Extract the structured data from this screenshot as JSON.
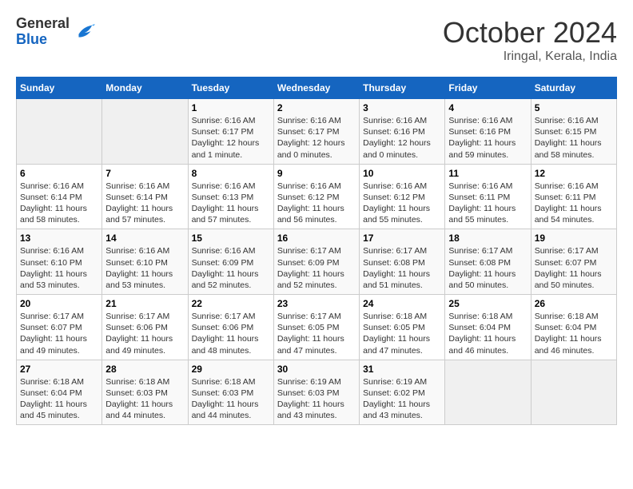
{
  "header": {
    "logo_general": "General",
    "logo_blue": "Blue",
    "month_title": "October 2024",
    "subtitle": "Iringal, Kerala, India"
  },
  "calendar": {
    "weekdays": [
      "Sunday",
      "Monday",
      "Tuesday",
      "Wednesday",
      "Thursday",
      "Friday",
      "Saturday"
    ],
    "weeks": [
      [
        {
          "day": "",
          "sunrise": "",
          "sunset": "",
          "daylight": "",
          "empty": true
        },
        {
          "day": "",
          "sunrise": "",
          "sunset": "",
          "daylight": "",
          "empty": true
        },
        {
          "day": "1",
          "sunrise": "Sunrise: 6:16 AM",
          "sunset": "Sunset: 6:17 PM",
          "daylight": "Daylight: 12 hours and 1 minute.",
          "empty": false
        },
        {
          "day": "2",
          "sunrise": "Sunrise: 6:16 AM",
          "sunset": "Sunset: 6:17 PM",
          "daylight": "Daylight: 12 hours and 0 minutes.",
          "empty": false
        },
        {
          "day": "3",
          "sunrise": "Sunrise: 6:16 AM",
          "sunset": "Sunset: 6:16 PM",
          "daylight": "Daylight: 12 hours and 0 minutes.",
          "empty": false
        },
        {
          "day": "4",
          "sunrise": "Sunrise: 6:16 AM",
          "sunset": "Sunset: 6:16 PM",
          "daylight": "Daylight: 11 hours and 59 minutes.",
          "empty": false
        },
        {
          "day": "5",
          "sunrise": "Sunrise: 6:16 AM",
          "sunset": "Sunset: 6:15 PM",
          "daylight": "Daylight: 11 hours and 58 minutes.",
          "empty": false
        }
      ],
      [
        {
          "day": "6",
          "sunrise": "Sunrise: 6:16 AM",
          "sunset": "Sunset: 6:14 PM",
          "daylight": "Daylight: 11 hours and 58 minutes.",
          "empty": false
        },
        {
          "day": "7",
          "sunrise": "Sunrise: 6:16 AM",
          "sunset": "Sunset: 6:14 PM",
          "daylight": "Daylight: 11 hours and 57 minutes.",
          "empty": false
        },
        {
          "day": "8",
          "sunrise": "Sunrise: 6:16 AM",
          "sunset": "Sunset: 6:13 PM",
          "daylight": "Daylight: 11 hours and 57 minutes.",
          "empty": false
        },
        {
          "day": "9",
          "sunrise": "Sunrise: 6:16 AM",
          "sunset": "Sunset: 6:12 PM",
          "daylight": "Daylight: 11 hours and 56 minutes.",
          "empty": false
        },
        {
          "day": "10",
          "sunrise": "Sunrise: 6:16 AM",
          "sunset": "Sunset: 6:12 PM",
          "daylight": "Daylight: 11 hours and 55 minutes.",
          "empty": false
        },
        {
          "day": "11",
          "sunrise": "Sunrise: 6:16 AM",
          "sunset": "Sunset: 6:11 PM",
          "daylight": "Daylight: 11 hours and 55 minutes.",
          "empty": false
        },
        {
          "day": "12",
          "sunrise": "Sunrise: 6:16 AM",
          "sunset": "Sunset: 6:11 PM",
          "daylight": "Daylight: 11 hours and 54 minutes.",
          "empty": false
        }
      ],
      [
        {
          "day": "13",
          "sunrise": "Sunrise: 6:16 AM",
          "sunset": "Sunset: 6:10 PM",
          "daylight": "Daylight: 11 hours and 53 minutes.",
          "empty": false
        },
        {
          "day": "14",
          "sunrise": "Sunrise: 6:16 AM",
          "sunset": "Sunset: 6:10 PM",
          "daylight": "Daylight: 11 hours and 53 minutes.",
          "empty": false
        },
        {
          "day": "15",
          "sunrise": "Sunrise: 6:16 AM",
          "sunset": "Sunset: 6:09 PM",
          "daylight": "Daylight: 11 hours and 52 minutes.",
          "empty": false
        },
        {
          "day": "16",
          "sunrise": "Sunrise: 6:17 AM",
          "sunset": "Sunset: 6:09 PM",
          "daylight": "Daylight: 11 hours and 52 minutes.",
          "empty": false
        },
        {
          "day": "17",
          "sunrise": "Sunrise: 6:17 AM",
          "sunset": "Sunset: 6:08 PM",
          "daylight": "Daylight: 11 hours and 51 minutes.",
          "empty": false
        },
        {
          "day": "18",
          "sunrise": "Sunrise: 6:17 AM",
          "sunset": "Sunset: 6:08 PM",
          "daylight": "Daylight: 11 hours and 50 minutes.",
          "empty": false
        },
        {
          "day": "19",
          "sunrise": "Sunrise: 6:17 AM",
          "sunset": "Sunset: 6:07 PM",
          "daylight": "Daylight: 11 hours and 50 minutes.",
          "empty": false
        }
      ],
      [
        {
          "day": "20",
          "sunrise": "Sunrise: 6:17 AM",
          "sunset": "Sunset: 6:07 PM",
          "daylight": "Daylight: 11 hours and 49 minutes.",
          "empty": false
        },
        {
          "day": "21",
          "sunrise": "Sunrise: 6:17 AM",
          "sunset": "Sunset: 6:06 PM",
          "daylight": "Daylight: 11 hours and 49 minutes.",
          "empty": false
        },
        {
          "day": "22",
          "sunrise": "Sunrise: 6:17 AM",
          "sunset": "Sunset: 6:06 PM",
          "daylight": "Daylight: 11 hours and 48 minutes.",
          "empty": false
        },
        {
          "day": "23",
          "sunrise": "Sunrise: 6:17 AM",
          "sunset": "Sunset: 6:05 PM",
          "daylight": "Daylight: 11 hours and 47 minutes.",
          "empty": false
        },
        {
          "day": "24",
          "sunrise": "Sunrise: 6:18 AM",
          "sunset": "Sunset: 6:05 PM",
          "daylight": "Daylight: 11 hours and 47 minutes.",
          "empty": false
        },
        {
          "day": "25",
          "sunrise": "Sunrise: 6:18 AM",
          "sunset": "Sunset: 6:04 PM",
          "daylight": "Daylight: 11 hours and 46 minutes.",
          "empty": false
        },
        {
          "day": "26",
          "sunrise": "Sunrise: 6:18 AM",
          "sunset": "Sunset: 6:04 PM",
          "daylight": "Daylight: 11 hours and 46 minutes.",
          "empty": false
        }
      ],
      [
        {
          "day": "27",
          "sunrise": "Sunrise: 6:18 AM",
          "sunset": "Sunset: 6:04 PM",
          "daylight": "Daylight: 11 hours and 45 minutes.",
          "empty": false
        },
        {
          "day": "28",
          "sunrise": "Sunrise: 6:18 AM",
          "sunset": "Sunset: 6:03 PM",
          "daylight": "Daylight: 11 hours and 44 minutes.",
          "empty": false
        },
        {
          "day": "29",
          "sunrise": "Sunrise: 6:18 AM",
          "sunset": "Sunset: 6:03 PM",
          "daylight": "Daylight: 11 hours and 44 minutes.",
          "empty": false
        },
        {
          "day": "30",
          "sunrise": "Sunrise: 6:19 AM",
          "sunset": "Sunset: 6:03 PM",
          "daylight": "Daylight: 11 hours and 43 minutes.",
          "empty": false
        },
        {
          "day": "31",
          "sunrise": "Sunrise: 6:19 AM",
          "sunset": "Sunset: 6:02 PM",
          "daylight": "Daylight: 11 hours and 43 minutes.",
          "empty": false
        },
        {
          "day": "",
          "sunrise": "",
          "sunset": "",
          "daylight": "",
          "empty": true
        },
        {
          "day": "",
          "sunrise": "",
          "sunset": "",
          "daylight": "",
          "empty": true
        }
      ]
    ]
  }
}
